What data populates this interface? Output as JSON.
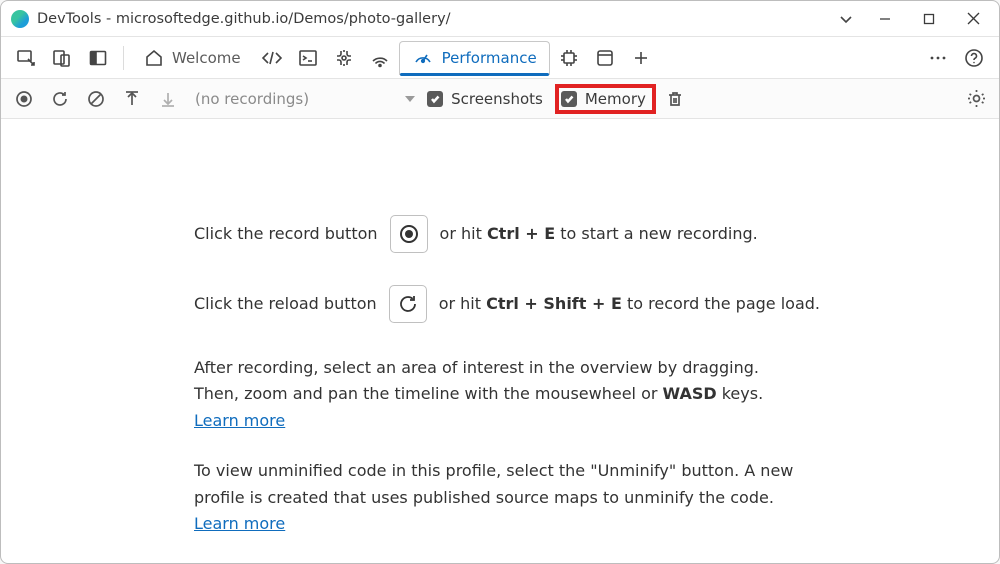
{
  "window": {
    "title": "DevTools - microsoftedge.github.io/Demos/photo-gallery/"
  },
  "tabs": {
    "welcome": "Welcome",
    "performance": "Performance"
  },
  "toolbar": {
    "recordings_placeholder": "(no recordings)",
    "screenshots_label": "Screenshots",
    "memory_label": "Memory"
  },
  "content": {
    "row1_pre": "Click the record button",
    "row1_post_a": "or hit ",
    "row1_kbd": "Ctrl + E",
    "row1_post_b": " to start a new recording.",
    "row2_pre": "Click the reload button",
    "row2_post_a": "or hit ",
    "row2_kbd": "Ctrl + Shift + E",
    "row2_post_b": " to record the page load.",
    "p1_a": "After recording, select an area of interest in the overview by dragging. Then, zoom and pan the timeline with the mousewheel or ",
    "p1_kbd": "WASD",
    "p1_b": " keys. ",
    "p1_link": "Learn more",
    "p2_a": "To view unminified code in this profile, select the \"Unminify\" button. A new profile is created that uses published source maps to unminify the code. ",
    "p2_link": "Learn more"
  }
}
